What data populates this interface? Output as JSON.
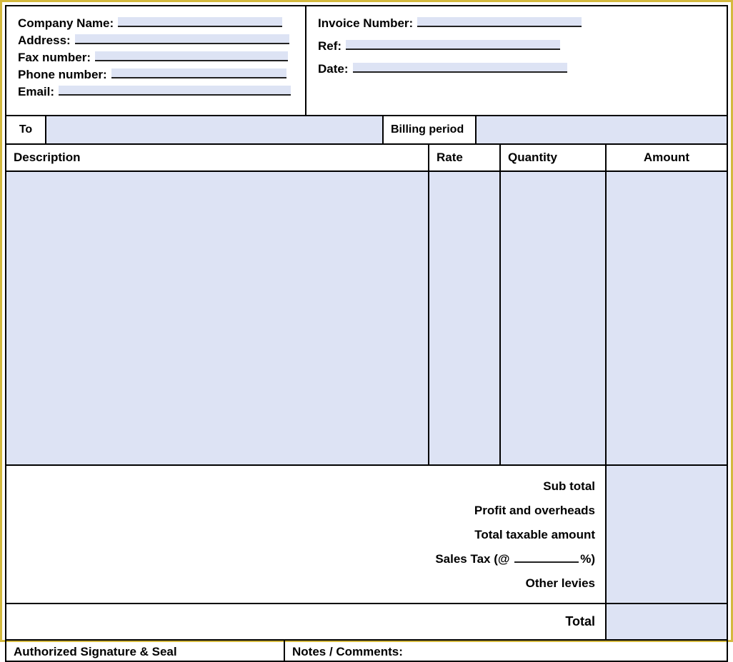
{
  "header": {
    "left": {
      "company_name_label": "Company Name:",
      "address_label": "Address:",
      "fax_label": "Fax number:",
      "phone_label": "Phone number:",
      "email_label": "Email:",
      "company_name": "",
      "address": "",
      "fax": "",
      "phone": "",
      "email": ""
    },
    "right": {
      "invoice_number_label": "Invoice Number:",
      "ref_label": "Ref:",
      "date_label": "Date:",
      "invoice_number": "",
      "ref": "",
      "date": ""
    }
  },
  "to_row": {
    "to_label": "To",
    "to_value": "",
    "billing_period_label": "Billing period",
    "billing_period_value": ""
  },
  "columns": {
    "description": "Description",
    "rate": "Rate",
    "quantity": "Quantity",
    "amount": "Amount"
  },
  "totals": {
    "sub_total": "Sub total",
    "profit_overheads": "Profit and overheads",
    "taxable_amount": "Total taxable amount",
    "sales_tax_prefix": "Sales Tax (@",
    "sales_tax_suffix": "%)",
    "sales_tax_rate": "",
    "other_levies": "Other levies",
    "total": "Total"
  },
  "footer": {
    "signature_label": "Authorized Signature & Seal",
    "notes_label": "Notes / Comments:"
  }
}
